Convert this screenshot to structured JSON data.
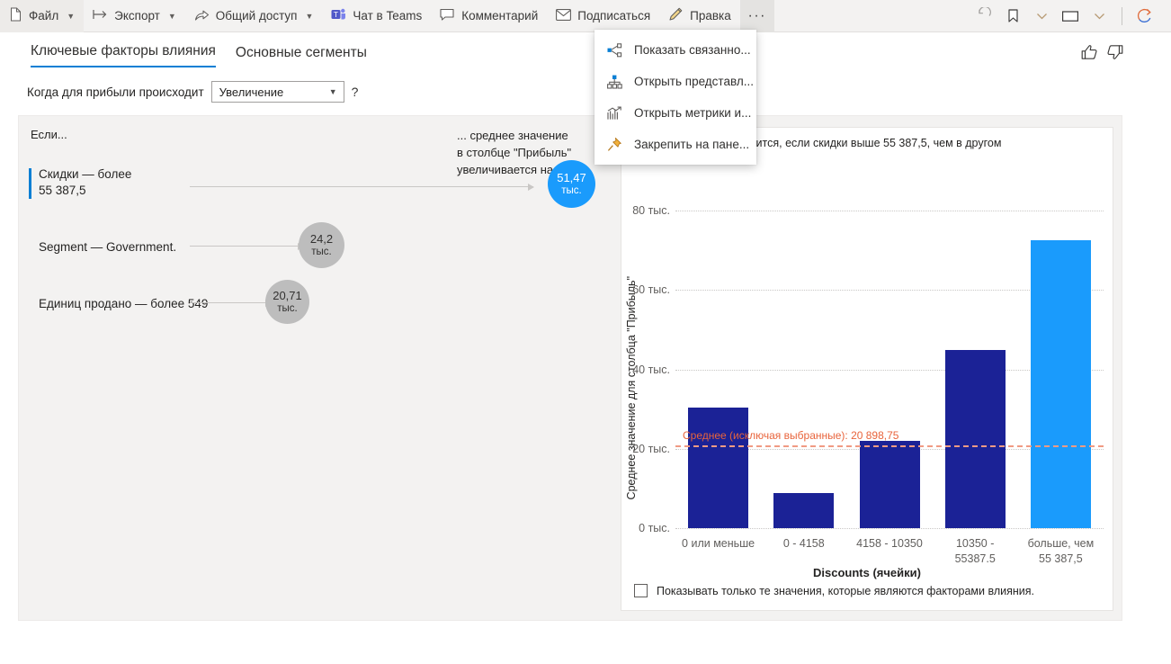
{
  "toolbar": {
    "items": [
      {
        "label": "Файл",
        "icon": "file-icon",
        "chevron": true
      },
      {
        "label": "Экспорт",
        "icon": "export-icon",
        "chevron": true
      },
      {
        "label": "Общий доступ",
        "icon": "share-icon",
        "chevron": true
      },
      {
        "label": "Чат в Teams",
        "icon": "teams-icon",
        "chevron": false
      },
      {
        "label": "Комментарий",
        "icon": "comment-icon",
        "chevron": false
      },
      {
        "label": "Подписаться",
        "icon": "subscribe-icon",
        "chevron": false
      },
      {
        "label": "Правка",
        "icon": "edit-pencil-icon",
        "chevron": false
      }
    ],
    "ellipsis_label": "···",
    "right_icons": [
      "reset-icon",
      "bookmark-icon",
      "bookmark-chevron-icon",
      "view-icon",
      "view-chevron-icon",
      "refresh-icon"
    ]
  },
  "menu": {
    "items": [
      {
        "label": "Показать связанно...",
        "icon": "related-content-icon"
      },
      {
        "label": "Открыть представл...",
        "icon": "lineage-view-icon"
      },
      {
        "label": "Открыть метрики и...",
        "icon": "usage-metrics-icon"
      },
      {
        "label": "Закрепить на пане...",
        "icon": "pin-icon"
      }
    ]
  },
  "tabs": [
    {
      "label": "Ключевые факторы влияния",
      "active": true
    },
    {
      "label": "Основные сегменты",
      "active": false
    }
  ],
  "feedback": {
    "like_icon": "thumbs-up-icon",
    "dislike_icon": "thumbs-down-icon"
  },
  "question": {
    "label": "Когда для прибыли происходит",
    "select_value": "Увеличение",
    "help": "?"
  },
  "influencers": {
    "if_label": "Если...",
    "right_caption": "... среднее значение\nв столбце \"Прибыль\"\nувеличивается на",
    "rows": [
      {
        "label": "Скидки — более\n55 387,5",
        "value_main": "51,47",
        "value_unit": "тыс.",
        "selected": true,
        "style": "blue"
      },
      {
        "label": "Segment — Government.",
        "value_main": "24,2",
        "value_unit": "тыс.",
        "selected": false,
        "style": "gray"
      },
      {
        "label": "Единиц продано — более 549",
        "value_main": "20,71",
        "value_unit": "тыс.",
        "selected": false,
        "style": "gray"
      }
    ]
  },
  "chart_panel": {
    "title": "...вероятностью увеличится, если скидки выше 55 387,5, чем в другом",
    "checkbox_label": "Показывать только те значения, которые являются факторами влияния.",
    "checkbox_checked": false
  },
  "chart_data": {
    "type": "bar",
    "title": "...вероятностью увеличится, если скидки выше 55 387,5, чем в другом",
    "xlabel": "Discounts (ячейки)",
    "ylabel": "Среднее значение для столбца \"Прибыль\"",
    "categories": [
      "0 или меньше",
      "0 - 4158",
      "4158 - 10350",
      "10350 -\n55387.5",
      "больше, чем\n55 387,5"
    ],
    "values": [
      30500,
      8800,
      22000,
      44800,
      72500
    ],
    "bar_colors": [
      "#1b2296",
      "#1b2296",
      "#1b2296",
      "#1b2296",
      "#1a9bfc"
    ],
    "ylim": [
      0,
      88000
    ],
    "yticks": [
      0,
      20000,
      40000,
      60000,
      80000
    ],
    "ytick_labels": [
      "0 тыс.",
      "20 тыс.",
      "40 тыс.",
      "60 тыс.",
      "80 тыс."
    ],
    "grid": true,
    "legend": "none",
    "reference_line": {
      "label": "Среднее (исключая выбранные): 20 898,75",
      "value": 20898.75,
      "color": "#f09b84"
    }
  },
  "colors": {
    "accent_blue": "#0a7fd4",
    "bubble_blue": "#1a9bfc",
    "bubble_gray": "#bdbdbd",
    "bar_dark": "#1b2296",
    "bar_light": "#1a9bfc",
    "avg_line": "#f09b84",
    "avg_text": "#e8643c"
  }
}
